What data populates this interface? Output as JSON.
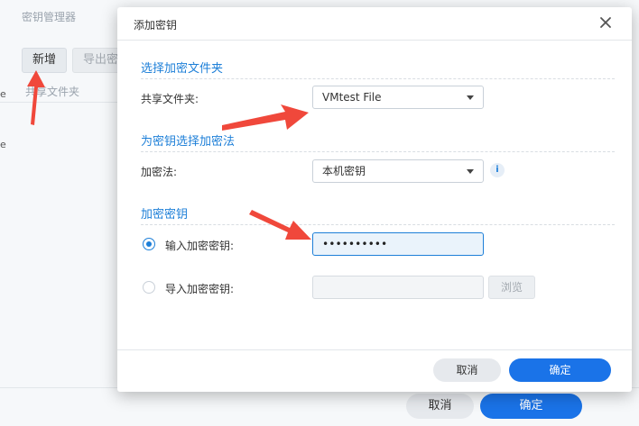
{
  "background": {
    "title": "密钥管理器",
    "toolbar": {
      "new_label": "新增",
      "export_label": "导出密"
    },
    "column_header": "共享文件夹",
    "left_fragments": [
      "e",
      "e"
    ],
    "footer": {
      "cancel_label": "取消",
      "ok_label": "确定"
    }
  },
  "dialog": {
    "title": "添加密钥",
    "close_icon": "close-icon",
    "section_folder": {
      "title": "选择加密文件夹",
      "label": "共享文件夹:",
      "value": "VMtest File"
    },
    "section_method": {
      "title": "为密钥选择加密法",
      "label": "加密法:",
      "value": "本机密钥",
      "info_icon": "i"
    },
    "section_key": {
      "title": "加密密钥",
      "input_option": {
        "label": "输入加密密钥:",
        "selected": true,
        "value": "••••••••••"
      },
      "import_option": {
        "label": "导入加密密钥:",
        "selected": false,
        "browse_label": "浏览"
      }
    },
    "footer": {
      "cancel_label": "取消",
      "ok_label": "确定"
    }
  },
  "colors": {
    "accent": "#1d7fd8",
    "primary_button": "#1a73e8",
    "annotation_arrow": "#f0483b"
  }
}
